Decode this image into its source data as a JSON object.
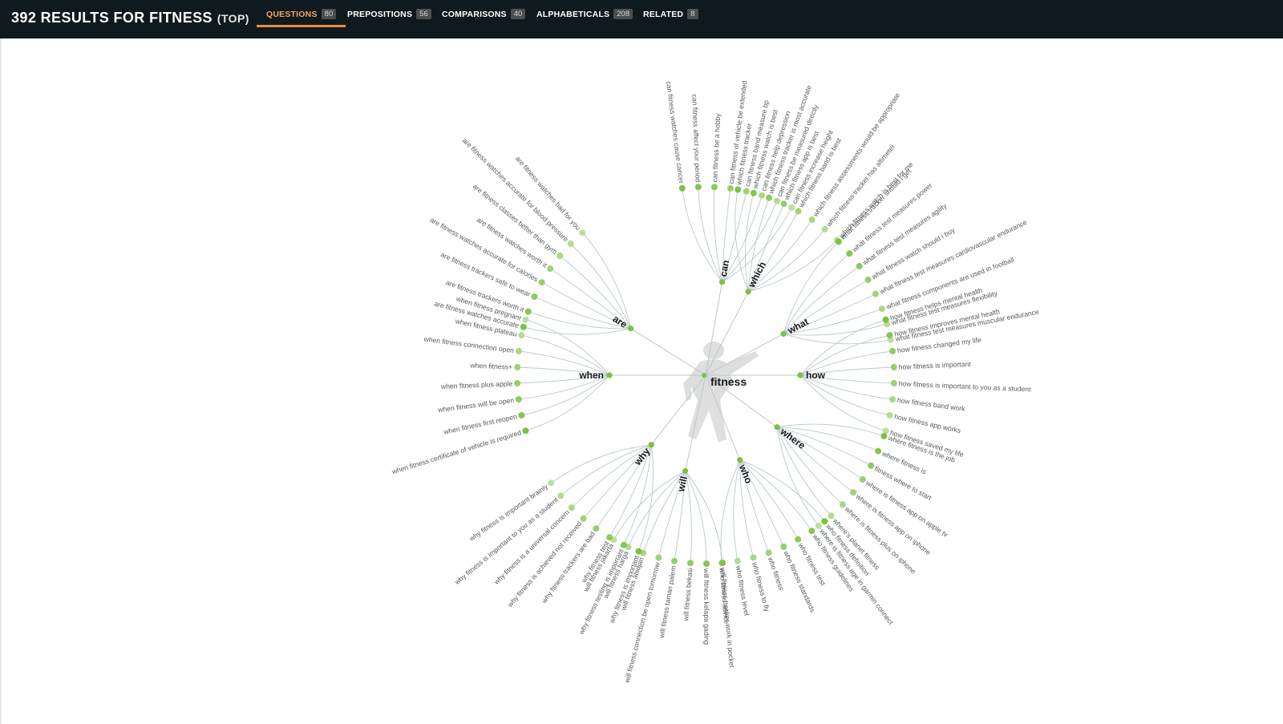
{
  "header": {
    "title": "392 RESULTS FOR FITNESS",
    "title_suffix": "(TOP)",
    "tabs": [
      {
        "label": "QUESTIONS",
        "count": "80",
        "active": true
      },
      {
        "label": "PREPOSITIONS",
        "count": "56",
        "active": false
      },
      {
        "label": "COMPARISONS",
        "count": "40",
        "active": false
      },
      {
        "label": "ALPHABETICALS",
        "count": "208",
        "active": false
      },
      {
        "label": "RELATED",
        "count": "8",
        "active": false
      }
    ]
  },
  "colors": {
    "header_bg": "#0f1a20",
    "active_tab": "#f5a25d",
    "node_green": "#7cc142",
    "node_light": "#d9ecc4",
    "link": "#b9c8ce"
  },
  "wheel": {
    "hub": "fitness",
    "hub_figure": "silhouette-of-athlete",
    "branches": [
      {
        "label": "can",
        "leaves": [
          {
            "text": "can fitness watches cause cancer",
            "strength": 1.0
          },
          {
            "text": "can fitness affect your period",
            "strength": 0.9
          },
          {
            "text": "can fitness be a hobby",
            "strength": 0.8
          },
          {
            "text": "can fitness of vehicle be extended",
            "strength": 0.7
          },
          {
            "text": "can fitness band measure bp",
            "strength": 0.6
          },
          {
            "text": "can fitness help depression",
            "strength": 0.5
          },
          {
            "text": "can fitness be measured directly",
            "strength": 0.4
          },
          {
            "text": "can fitness increase height",
            "strength": 0.3
          }
        ]
      },
      {
        "label": "which",
        "leaves": [
          {
            "text": "which fitness tracker",
            "strength": 1.0
          },
          {
            "text": "which fitness watch is best",
            "strength": 0.9
          },
          {
            "text": "which fitness tracker is most accurate",
            "strength": 0.8
          },
          {
            "text": "which fitness app is best",
            "strength": 0.7
          },
          {
            "text": "which fitness band is best",
            "strength": 0.6
          },
          {
            "text": "which fitness assessments would be appropriate",
            "strength": 0.5
          },
          {
            "text": "which fitness tracker has altimeter",
            "strength": 0.4
          },
          {
            "text": "which fitness watch is best for me",
            "strength": 0.3
          }
        ]
      },
      {
        "label": "what",
        "leaves": [
          {
            "text": "what fitness tracker should i get",
            "strength": 1.0
          },
          {
            "text": "what fitness test measures power",
            "strength": 0.9
          },
          {
            "text": "what fitness test measures agility",
            "strength": 0.8
          },
          {
            "text": "what fitness watch should i buy",
            "strength": 0.7
          },
          {
            "text": "what fitness test measures cardiovascular endurance",
            "strength": 0.6
          },
          {
            "text": "what fitness components are used in football",
            "strength": 0.5
          },
          {
            "text": "what fitness test measures flexibility",
            "strength": 0.4
          },
          {
            "text": "what fitness test measures muscular endurance",
            "strength": 0.3
          }
        ]
      },
      {
        "label": "how",
        "leaves": [
          {
            "text": "how fitness helps mental health",
            "strength": 1.0
          },
          {
            "text": "how fitness improves mental health",
            "strength": 0.9
          },
          {
            "text": "how fitness changed my life",
            "strength": 0.8
          },
          {
            "text": "how fitness is important",
            "strength": 0.7
          },
          {
            "text": "how fitness is important to you as a student",
            "strength": 0.6
          },
          {
            "text": "how fitness band work",
            "strength": 0.5
          },
          {
            "text": "how fitness app works",
            "strength": 0.4
          },
          {
            "text": "how fitness saved my life",
            "strength": 0.3
          }
        ]
      },
      {
        "label": "where",
        "leaves": [
          {
            "text": "where fitness is the job",
            "strength": 1.0
          },
          {
            "text": "where fitness is",
            "strength": 0.9
          },
          {
            "text": "fitness where to start",
            "strength": 0.8
          },
          {
            "text": "where is fitness app on apple tv",
            "strength": 0.7
          },
          {
            "text": "where is fitness app on iphone",
            "strength": 0.6
          },
          {
            "text": "where is fitness plus on iphone",
            "strength": 0.5
          },
          {
            "text": "where's planet fitness",
            "strength": 0.4
          },
          {
            "text": "where is fitness age in garmin connect",
            "strength": 0.3
          }
        ]
      },
      {
        "label": "who",
        "leaves": [
          {
            "text": "who fitness definition",
            "strength": 1.0
          },
          {
            "text": "who fitness guidelines",
            "strength": 0.9
          },
          {
            "text": "who fitness test",
            "strength": 0.8
          },
          {
            "text": "who fitness standards",
            "strength": 0.7
          },
          {
            "text": "who fitness",
            "strength": 0.6
          },
          {
            "text": "who fitness to fly",
            "strength": 0.5
          },
          {
            "text": "who fitness level",
            "strength": 0.4
          },
          {
            "text": "who fitness advice",
            "strength": 0.3
          }
        ]
      },
      {
        "label": "will",
        "leaves": [
          {
            "text": "will fitness tracker work in pocket",
            "strength": 1.0
          },
          {
            "text": "will fitness kelapa gading",
            "strength": 0.9
          },
          {
            "text": "will fitness bekasi",
            "strength": 0.8
          },
          {
            "text": "will fitness taman palem",
            "strength": 0.7
          },
          {
            "text": "will fitness connection be open tomorrow",
            "strength": 0.6
          },
          {
            "text": "will fitness abidjan",
            "strength": 0.5
          },
          {
            "text": "will fitness harga",
            "strength": 0.4
          },
          {
            "text": "will fitness jakarta",
            "strength": 0.3
          }
        ]
      },
      {
        "label": "why",
        "leaves": [
          {
            "text": "why fitness is important",
            "strength": 1.0
          },
          {
            "text": "why fitness testing is important",
            "strength": 0.9
          },
          {
            "text": "why fitness test",
            "strength": 0.8
          },
          {
            "text": "why fitness trackers are bad",
            "strength": 0.7
          },
          {
            "text": "why fitness is achieved not received",
            "strength": 0.6
          },
          {
            "text": "why fitness is a universal concern",
            "strength": 0.5
          },
          {
            "text": "why fitness is important to you as a student",
            "strength": 0.4
          },
          {
            "text": "why fitness is important brainly",
            "strength": 0.3
          }
        ]
      },
      {
        "label": "when",
        "leaves": [
          {
            "text": "when fitness certificate of vehicle is required",
            "strength": 1.0
          },
          {
            "text": "when fitness first reopen",
            "strength": 0.9
          },
          {
            "text": "when fitness will be open",
            "strength": 0.8
          },
          {
            "text": "when fitness plus apple",
            "strength": 0.7
          },
          {
            "text": "when fitness+",
            "strength": 0.6
          },
          {
            "text": "when fitness connection open",
            "strength": 0.5
          },
          {
            "text": "when fitness plateau",
            "strength": 0.4
          },
          {
            "text": "when fitness pregnant",
            "strength": 0.3
          }
        ]
      },
      {
        "label": "are",
        "leaves": [
          {
            "text": "are fitness watches accurate",
            "strength": 1.0
          },
          {
            "text": "are fitness trackers worth it",
            "strength": 0.9
          },
          {
            "text": "are fitness trackers safe to wear",
            "strength": 0.8
          },
          {
            "text": "are fitness watches accurate for calories",
            "strength": 0.7
          },
          {
            "text": "are fitness watches worth it",
            "strength": 0.6
          },
          {
            "text": "are fitness classes better than gym",
            "strength": 0.5
          },
          {
            "text": "are fitness watches accurate for blood pressure",
            "strength": 0.4
          },
          {
            "text": "are fitness watches bad for you",
            "strength": 0.3
          }
        ]
      }
    ]
  }
}
